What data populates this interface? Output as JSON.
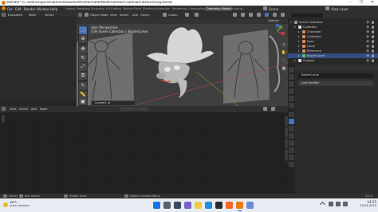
{
  "window": {
    "title": "Blender* [C:\\Users\\super\\OneDrive\\Dokumente\\Informatik\\Modernwestern\\Tutorials\\Texturierung.blend]"
  },
  "menubar": {
    "menus": [
      "File",
      "Edit",
      "Render",
      "Window",
      "Help"
    ],
    "workspaces": [
      "Layout",
      "Modeling",
      "Sculpting",
      "UV Editing",
      "Texture Paint",
      "Shading",
      "Animation",
      "Rendering",
      "Compositing",
      "Geometry Nodes",
      "Scripting"
    ],
    "active_workspace": "Geometry Nodes",
    "scene": "Scene",
    "view_layer": "View Layer"
  },
  "left_editor": {
    "view_label": "View",
    "menu_items": [
      "View",
      "Image"
    ],
    "overlay_label": "Evaluated",
    "mesh_label": "Mesh",
    "vertex_label": "Vertex"
  },
  "viewport": {
    "mode": "Object Mode",
    "menus": [
      "View",
      "Select",
      "Add",
      "Object"
    ],
    "transform_orientation": "Global",
    "options_label": "Options",
    "overlay_line1": "User Perspective",
    "overlay_line2": "(19) Scene Collection | BezierCurve",
    "bottom_operator": "Convert To",
    "axis_labels": {
      "x": "X",
      "y": "Y",
      "z": "Z"
    }
  },
  "outliner": {
    "items": [
      {
        "label": "Scene Collection",
        "indent": 0,
        "icon_color": "#9a9a9a",
        "expanded": true,
        "selected": false
      },
      {
        "label": "Collection",
        "indent": 1,
        "icon_color": "#d9d9d9",
        "expanded": true,
        "selected": false
      },
      {
        "label": "Character",
        "indent": 2,
        "icon_color": "#e38a4a",
        "expanded": false,
        "selected": false
      },
      {
        "label": "Collection",
        "indent": 2,
        "icon_color": "#e38a4a",
        "expanded": false,
        "selected": false
      },
      {
        "label": "Eyes",
        "indent": 2,
        "icon_color": "#e38a4a",
        "expanded": false,
        "selected": false
      },
      {
        "label": "Lamp",
        "indent": 2,
        "icon_color": "#e38a4a",
        "expanded": false,
        "selected": false
      },
      {
        "label": "Reference",
        "indent": 2,
        "icon_color": "#e38a4a",
        "expanded": false,
        "selected": false
      },
      {
        "label": "BezierCurve",
        "indent": 2,
        "icon_color": "#4ac94a",
        "expanded": false,
        "selected": true
      },
      {
        "label": "Cowboy",
        "indent": 1,
        "icon_color": "#d9d9d9",
        "expanded": true,
        "selected": false
      }
    ]
  },
  "properties": {
    "object_name": "BezierCurve",
    "add_modifier_label": "Add Modifier"
  },
  "node_editor": {
    "menus": [
      "View",
      "Select",
      "Add",
      "Node"
    ]
  },
  "statusbar": {
    "select_label": "Select",
    "box_select_label": "Box Select",
    "rotate_label": "Rotate View",
    "context_menu_label": "Object Context Menu",
    "version": "3.0.0"
  },
  "taskbar": {
    "temperature": "18°C",
    "weather_desc": "Stark bewölkt",
    "time": "14:55",
    "date": "25.04.2022"
  },
  "colors": {
    "accent_blue": "#4772b3",
    "selection": "#334d80",
    "blender_orange": "#e87d0d"
  }
}
